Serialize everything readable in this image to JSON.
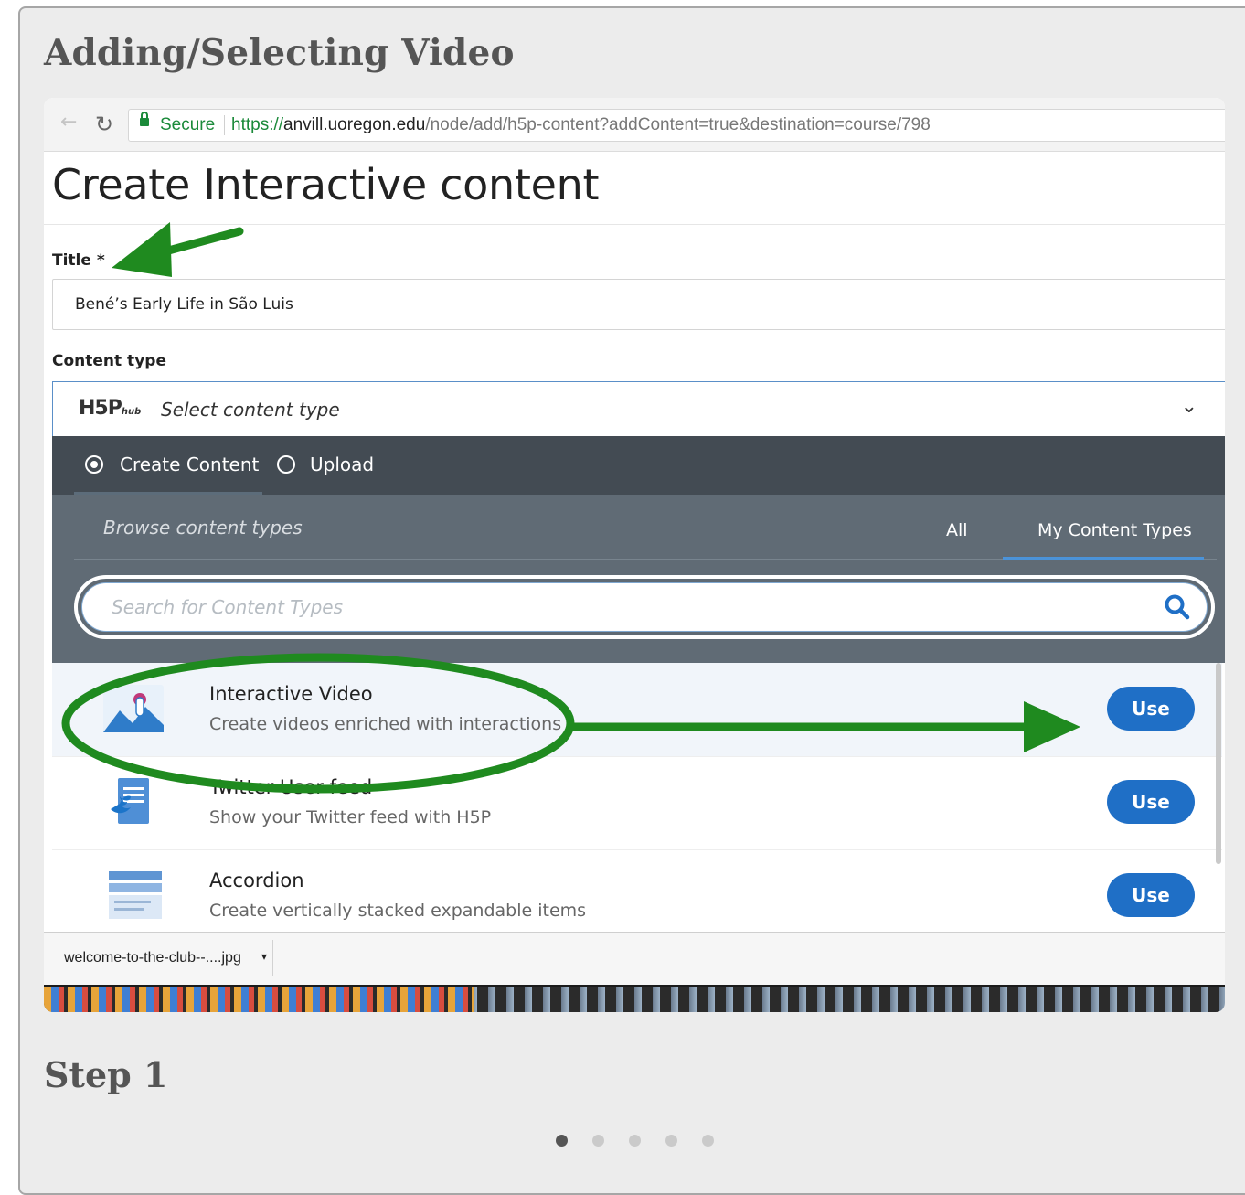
{
  "card": {
    "title": "Adding/Selecting Video",
    "step_label": "Step 1"
  },
  "browser": {
    "secure_label": "Secure",
    "url_protocol": "https://",
    "url_host": "anvill.uoregon.edu",
    "url_path": "/node/add/h5p-content?addContent=true&destination=course/798"
  },
  "page": {
    "heading": "Create Interactive content",
    "title_label": "Title *",
    "title_value": "Bené’s Early Life in São Luis",
    "content_type_label": "Content type"
  },
  "h5p": {
    "logo_text": "H5P",
    "logo_sub": "hub",
    "select_placeholder": "Select content type",
    "tabs": [
      {
        "label": "Create Content",
        "selected": true
      },
      {
        "label": "Upload",
        "selected": false
      }
    ],
    "browse_title": "Browse content types",
    "filters": [
      {
        "label": "All"
      },
      {
        "label": "My Content Types"
      }
    ],
    "search_placeholder": "Search for Content Types",
    "items": [
      {
        "title": "Interactive Video",
        "description": "Create videos enriched with interactions",
        "button": "Use",
        "icon": "interactive-video-icon"
      },
      {
        "title": "Twitter User feed",
        "description": "Show your Twitter feed with H5P",
        "button": "Use",
        "icon": "twitter-feed-icon"
      },
      {
        "title": "Accordion",
        "description": "Create vertically stacked expandable items",
        "button": "Use",
        "icon": "accordion-icon"
      }
    ]
  },
  "downloads": {
    "file_name": "welcome-to-the-club--....jpg"
  },
  "annotation": {
    "color": "#1f8a1f"
  },
  "pagination": {
    "count": 5,
    "active_index": 0
  },
  "colors": {
    "accent": "#1f6fc6",
    "tab_bar": "#434b53",
    "panel": "#606b75"
  }
}
